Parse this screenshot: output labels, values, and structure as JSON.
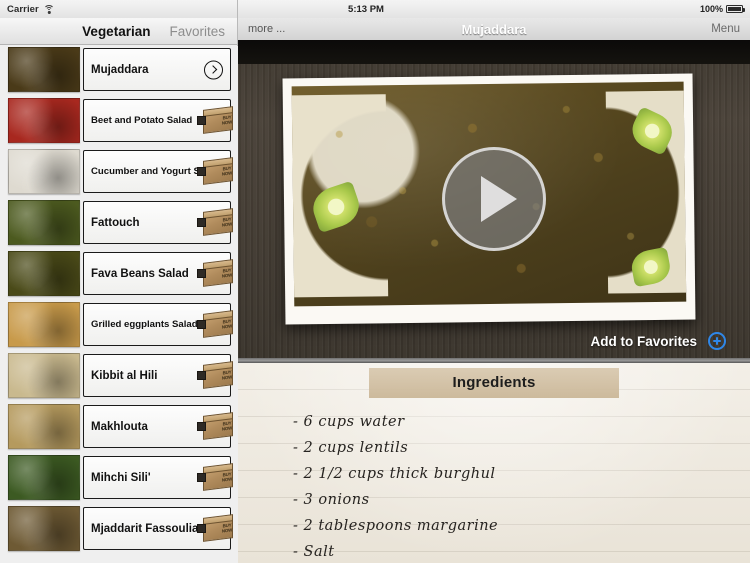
{
  "status_bar": {
    "carrier": "Carrier",
    "wifi_icon": "wifi-icon",
    "time": "5:13 PM",
    "battery_percent": "100%",
    "battery_icon": "battery-full-icon"
  },
  "sidebar": {
    "tabs": [
      {
        "label": "Vegetarian",
        "active": true
      },
      {
        "label": "Favorites",
        "active": false
      }
    ],
    "items": [
      {
        "label": "Mujaddara",
        "selected": true,
        "accessory": "disclosure-chevron",
        "thumb": "#4a3a18"
      },
      {
        "label": "Beet and Potato Salad",
        "selected": false,
        "accessory": "buy-now-box",
        "thumb": "#a8281f"
      },
      {
        "label": "Cucumber and Yogurt Salad",
        "selected": false,
        "accessory": "buy-now-box",
        "thumb": "#dedad0"
      },
      {
        "label": "Fattouch",
        "selected": false,
        "accessory": "buy-now-box",
        "thumb": "#4c5a1f"
      },
      {
        "label": "Fava Beans Salad",
        "selected": false,
        "accessory": "buy-now-box",
        "thumb": "#4a4a18"
      },
      {
        "label": "Grilled eggplants Salad",
        "selected": false,
        "accessory": "buy-now-box",
        "thumb": "#c89a4a"
      },
      {
        "label": "Kibbit al Hili",
        "selected": false,
        "accessory": "buy-now-box",
        "thumb": "#c9b98e"
      },
      {
        "label": "Makhlouta",
        "selected": false,
        "accessory": "buy-now-box",
        "thumb": "#b59a5e"
      },
      {
        "label": "Mihchi Sili'",
        "selected": false,
        "accessory": "buy-now-box",
        "thumb": "#3c5a22"
      },
      {
        "label": "Mjaddarit Fassoulia",
        "selected": false,
        "accessory": "buy-now-box",
        "thumb": "#6e5a34"
      }
    ],
    "buy_now_label_line1": "BUY",
    "buy_now_label_line2": "NOW"
  },
  "navbar": {
    "more_label": "more ...",
    "title": "Mujaddara",
    "menu_label": "Menu"
  },
  "media": {
    "play_button_icon": "play-icon",
    "add_to_favorites_label": "Add to Favorites",
    "add_icon": "plus-circle-icon"
  },
  "ingredients": {
    "heading": "Ingredients",
    "items": [
      "- 6 cups water",
      "- 2 cups lentils",
      "- 2 1/2 cups thick burghul",
      "- 3 onions",
      "- 2 tablespoons margarine",
      "- Salt"
    ]
  },
  "colors": {
    "accent_blue": "#2f87e8",
    "wood_dark": "#433c33",
    "paper": "#efeae0",
    "tape": "#c9b595"
  }
}
